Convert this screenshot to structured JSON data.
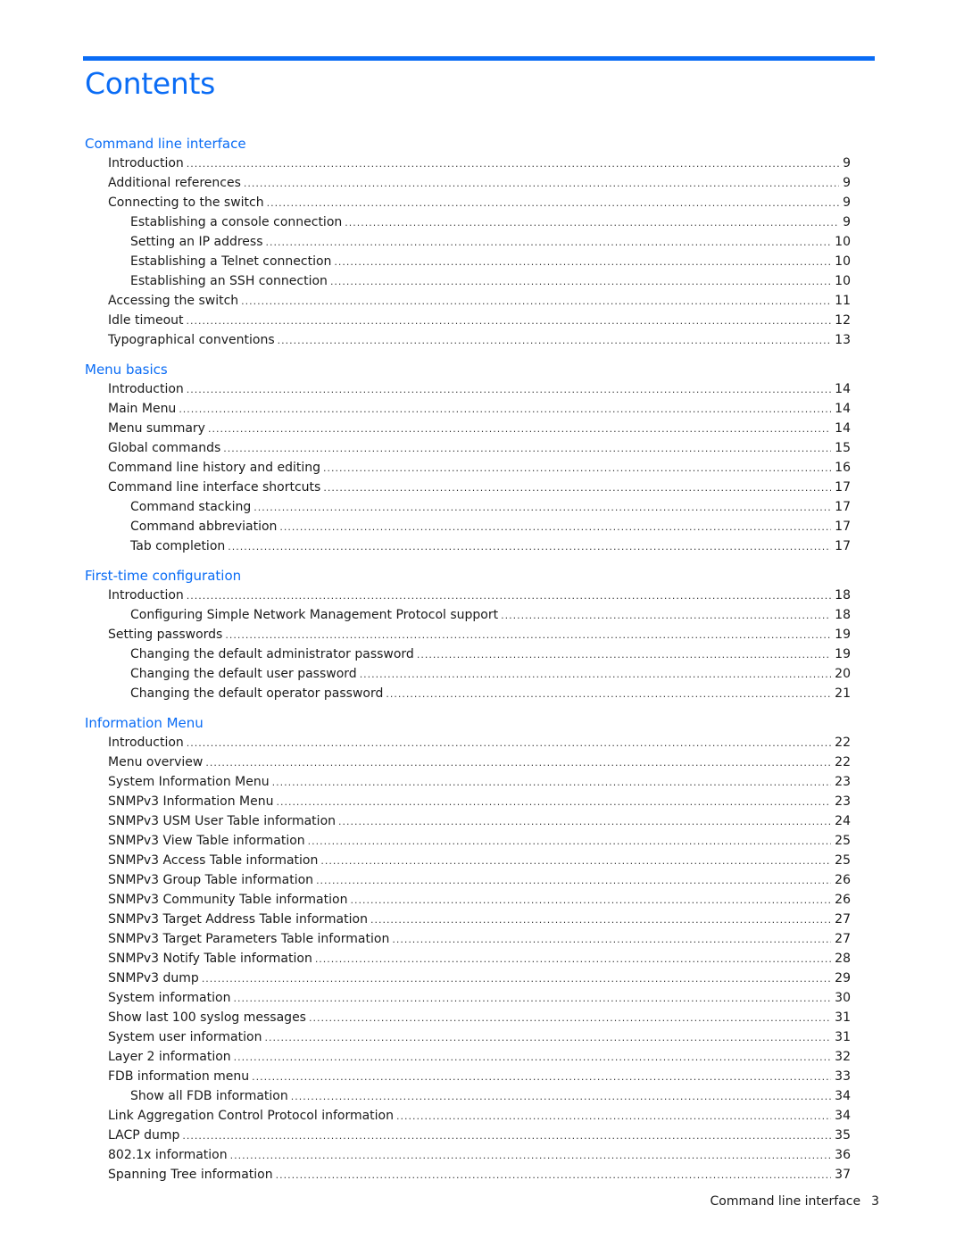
{
  "title": "Contents",
  "accent_color": "#0a6cf5",
  "sections": [
    {
      "heading": "Command line interface",
      "entries": [
        {
          "label": "Introduction",
          "page": "9",
          "level": 1
        },
        {
          "label": "Additional references",
          "page": "9",
          "level": 1
        },
        {
          "label": "Connecting to the switch",
          "page": "9",
          "level": 1
        },
        {
          "label": "Establishing a console connection",
          "page": "9",
          "level": 2
        },
        {
          "label": "Setting an IP address",
          "page": "10",
          "level": 2
        },
        {
          "label": "Establishing a Telnet connection",
          "page": "10",
          "level": 2
        },
        {
          "label": "Establishing an SSH connection",
          "page": "10",
          "level": 2
        },
        {
          "label": "Accessing the switch",
          "page": "11",
          "level": 1
        },
        {
          "label": "Idle timeout",
          "page": "12",
          "level": 1
        },
        {
          "label": "Typographical conventions",
          "page": "13",
          "level": 1
        }
      ]
    },
    {
      "heading": "Menu basics",
      "entries": [
        {
          "label": "Introduction",
          "page": "14",
          "level": 1
        },
        {
          "label": "Main Menu",
          "page": "14",
          "level": 1
        },
        {
          "label": "Menu summary",
          "page": "14",
          "level": 1
        },
        {
          "label": "Global commands",
          "page": "15",
          "level": 1
        },
        {
          "label": "Command line history and editing",
          "page": "16",
          "level": 1
        },
        {
          "label": "Command line interface shortcuts",
          "page": "17",
          "level": 1
        },
        {
          "label": "Command stacking",
          "page": "17",
          "level": 2
        },
        {
          "label": "Command abbreviation",
          "page": "17",
          "level": 2
        },
        {
          "label": "Tab completion",
          "page": "17",
          "level": 2
        }
      ]
    },
    {
      "heading": "First-time configuration",
      "entries": [
        {
          "label": "Introduction",
          "page": "18",
          "level": 1
        },
        {
          "label": "Configuring Simple Network Management Protocol support",
          "page": "18",
          "level": 2
        },
        {
          "label": "Setting passwords",
          "page": "19",
          "level": 1
        },
        {
          "label": "Changing the default administrator password",
          "page": "19",
          "level": 2
        },
        {
          "label": "Changing the default user password",
          "page": "20",
          "level": 2
        },
        {
          "label": "Changing the default operator password",
          "page": "21",
          "level": 2
        }
      ]
    },
    {
      "heading": "Information Menu",
      "entries": [
        {
          "label": "Introduction",
          "page": "22",
          "level": 1
        },
        {
          "label": "Menu overview",
          "page": "22",
          "level": 1
        },
        {
          "label": "System Information Menu",
          "page": "23",
          "level": 1
        },
        {
          "label": "SNMPv3 Information Menu",
          "page": "23",
          "level": 1
        },
        {
          "label": "SNMPv3 USM User Table information",
          "page": "24",
          "level": 1
        },
        {
          "label": "SNMPv3 View Table information",
          "page": "25",
          "level": 1
        },
        {
          "label": "SNMPv3 Access Table information",
          "page": "25",
          "level": 1
        },
        {
          "label": "SNMPv3 Group Table information",
          "page": "26",
          "level": 1
        },
        {
          "label": "SNMPv3 Community Table information",
          "page": "26",
          "level": 1
        },
        {
          "label": "SNMPv3 Target Address Table information",
          "page": "27",
          "level": 1
        },
        {
          "label": "SNMPv3 Target Parameters Table information",
          "page": "27",
          "level": 1
        },
        {
          "label": "SNMPv3 Notify Table information",
          "page": "28",
          "level": 1
        },
        {
          "label": "SNMPv3 dump",
          "page": "29",
          "level": 1
        },
        {
          "label": "System information",
          "page": "30",
          "level": 1
        },
        {
          "label": "Show last 100 syslog messages",
          "page": "31",
          "level": 1
        },
        {
          "label": "System user information",
          "page": "31",
          "level": 1
        },
        {
          "label": "Layer 2 information",
          "page": "32",
          "level": 1
        },
        {
          "label": "FDB information menu",
          "page": "33",
          "level": 1
        },
        {
          "label": "Show all FDB information",
          "page": "34",
          "level": 2
        },
        {
          "label": "Link Aggregation Control Protocol information",
          "page": "34",
          "level": 1
        },
        {
          "label": "LACP dump",
          "page": "35",
          "level": 1
        },
        {
          "label": "802.1x information",
          "page": "36",
          "level": 1
        },
        {
          "label": "Spanning Tree information",
          "page": "37",
          "level": 1
        }
      ]
    }
  ],
  "footer": {
    "chapter": "Command line interface",
    "page_number": "3"
  }
}
